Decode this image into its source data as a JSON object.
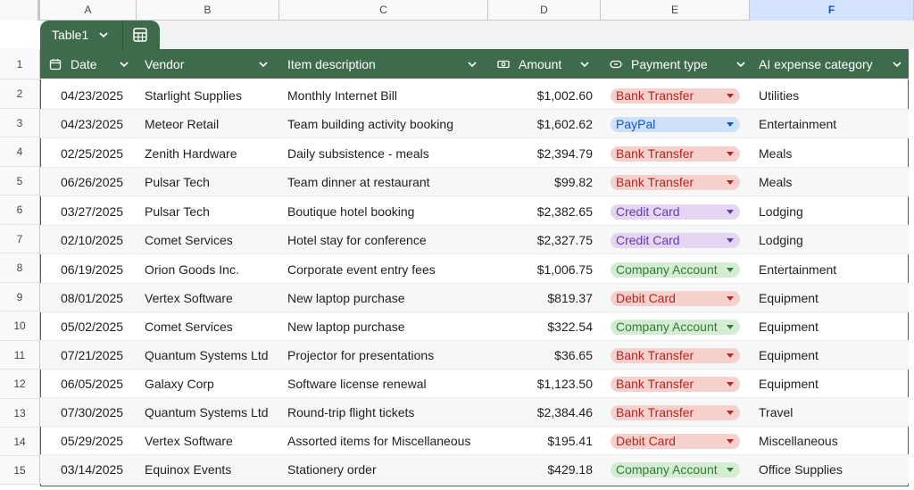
{
  "columns": {
    "letters": [
      "A",
      "B",
      "C",
      "D",
      "E",
      "F"
    ],
    "active": "F"
  },
  "table": {
    "name": "Table1",
    "headers": {
      "date": "Date",
      "vendor": "Vendor",
      "item": "Item description",
      "amount": "Amount",
      "payment": "Payment type",
      "category": "AI expense category"
    }
  },
  "row_numbers": [
    "1",
    "2",
    "3",
    "4",
    "5",
    "6",
    "7",
    "8",
    "9",
    "10",
    "11",
    "12",
    "13",
    "14",
    "15"
  ],
  "rows": [
    {
      "date": "04/23/2025",
      "vendor": "Starlight Supplies",
      "item": "Monthly Internet Bill",
      "amount": "$1,002.60",
      "payment": "Bank Transfer",
      "payment_color": "red",
      "category": "Utilities"
    },
    {
      "date": "04/23/2025",
      "vendor": "Meteor Retail",
      "item": "Team building activity booking",
      "amount": "$1,602.62",
      "payment": "PayPal",
      "payment_color": "blue",
      "category": "Entertainment"
    },
    {
      "date": "02/25/2025",
      "vendor": "Zenith Hardware",
      "item": "Daily subsistence - meals",
      "amount": "$2,394.79",
      "payment": "Bank Transfer",
      "payment_color": "red",
      "category": "Meals"
    },
    {
      "date": "06/26/2025",
      "vendor": "Pulsar Tech",
      "item": "Team dinner at restaurant",
      "amount": "$99.82",
      "payment": "Bank Transfer",
      "payment_color": "red",
      "category": "Meals"
    },
    {
      "date": "03/27/2025",
      "vendor": "Pulsar Tech",
      "item": "Boutique hotel booking",
      "amount": "$2,382.65",
      "payment": "Credit Card",
      "payment_color": "purple",
      "category": "Lodging"
    },
    {
      "date": "02/10/2025",
      "vendor": "Comet Services",
      "item": "Hotel stay for conference",
      "amount": "$2,327.75",
      "payment": "Credit Card",
      "payment_color": "purple",
      "category": "Lodging"
    },
    {
      "date": "06/19/2025",
      "vendor": "Orion Goods Inc.",
      "item": "Corporate event entry fees",
      "amount": "$1,006.75",
      "payment": "Company Account",
      "payment_color": "green",
      "category": "Entertainment"
    },
    {
      "date": "08/01/2025",
      "vendor": "Vertex Software",
      "item": "New laptop purchase",
      "amount": "$819.37",
      "payment": "Debit Card",
      "payment_color": "red",
      "category": "Equipment"
    },
    {
      "date": "05/02/2025",
      "vendor": "Comet Services",
      "item": "New laptop purchase",
      "amount": "$322.54",
      "payment": "Company Account",
      "payment_color": "green",
      "category": "Equipment"
    },
    {
      "date": "07/21/2025",
      "vendor": "Quantum Systems Ltd",
      "item": "Projector for presentations",
      "amount": "$36.65",
      "payment": "Bank Transfer",
      "payment_color": "red",
      "category": "Equipment"
    },
    {
      "date": "06/05/2025",
      "vendor": "Galaxy Corp",
      "item": "Software license renewal",
      "amount": "$1,123.50",
      "payment": "Bank Transfer",
      "payment_color": "red",
      "category": "Equipment"
    },
    {
      "date": "07/30/2025",
      "vendor": "Quantum Systems Ltd",
      "item": "Round-trip flight tickets",
      "amount": "$2,384.46",
      "payment": "Bank Transfer",
      "payment_color": "red",
      "category": "Travel"
    },
    {
      "date": "05/29/2025",
      "vendor": "Vertex Software",
      "item": "Assorted items for Miscellaneous",
      "amount": "$195.41",
      "payment": "Debit Card",
      "payment_color": "red",
      "category": "Miscellaneous"
    },
    {
      "date": "03/14/2025",
      "vendor": "Equinox Events",
      "item": "Stationery order",
      "amount": "$429.18",
      "payment": "Company Account",
      "payment_color": "green",
      "category": "Office Supplies"
    }
  ],
  "icons": {
    "date_header": "calendar-icon",
    "amount_header": "money-icon",
    "payment_header": "chip-icon",
    "table_tab_menu": "chevron-down-icon",
    "table_tab_action": "calculator-icon",
    "header_dropdown": "chevron-down-icon"
  },
  "colors": {
    "table_green": "#3e6b4b",
    "active_column": "#d3e3fd"
  }
}
